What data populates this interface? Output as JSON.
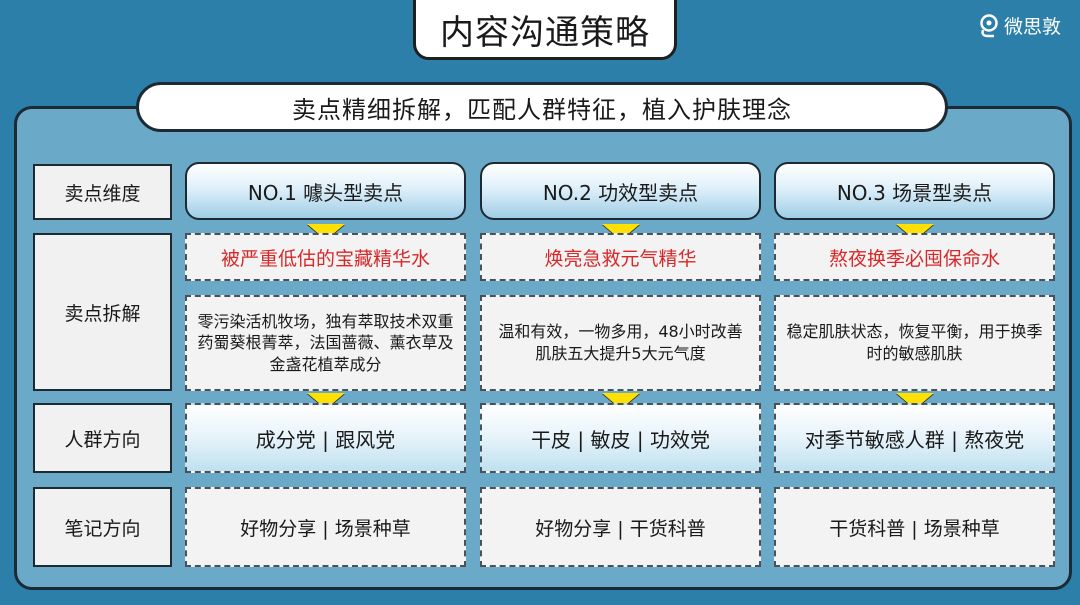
{
  "title": "内容沟通策略",
  "logo_text": "微思敦",
  "subtitle": "卖点精细拆解，匹配人群特征，植入护肤理念",
  "row_labels": {
    "dimension": "卖点维度",
    "breakdown": "卖点拆解",
    "audience": "人群方向",
    "notes": "笔记方向"
  },
  "columns": [
    {
      "header": "NO.1 噱头型卖点",
      "headline": "被严重低估的宝藏精华水",
      "description": "零污染活机牧场，独有萃取技术双重药蜀葵根菁萃，法国蔷薇、薰衣草及金盏花植萃成分",
      "audience": "成分党 | 跟风党",
      "notes": "好物分享 | 场景种草"
    },
    {
      "header": "NO.2 功效型卖点",
      "headline": "焕亮急救元气精华",
      "description": "温和有效，一物多用，48小时改善肌肤五大提升5大元气度",
      "audience": "干皮 | 敏皮 | 功效党",
      "notes": "好物分享 | 干货科普"
    },
    {
      "header": "NO.3 场景型卖点",
      "headline": "熬夜换季必囤保命水",
      "description": "稳定肌肤状态，恢复平衡，用于换季时的敏感肌肤",
      "audience": "对季节敏感人群 | 熬夜党",
      "notes": "干货科普 | 场景种草"
    }
  ],
  "colors": {
    "background": "#2c7fa8",
    "panel": "#6aa9c8",
    "headline_red": "#d7282a",
    "arrow_yellow": "#ffe000"
  }
}
